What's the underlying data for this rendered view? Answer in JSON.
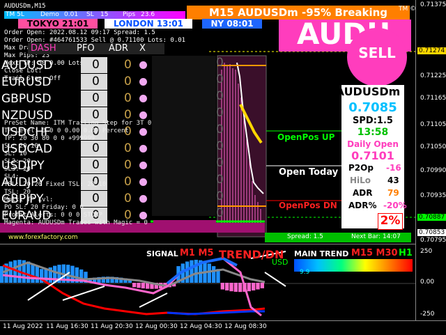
{
  "window": {
    "title": "AUDUSDm,M15"
  },
  "status_line": {
    "tm": "TM 5L",
    "demo": "Demo",
    "demo_val": "0.01",
    "sl_label": "SL",
    "sl_val": "15",
    "pips_label": "Pips",
    "pips_val": "23.6"
  },
  "banner": {
    "text": "M15 AUDUSDm -95% Breaking",
    "badge": "TM ©"
  },
  "sessions": {
    "tokyo": "TOKYO 21:01",
    "london": "LONDON 13:01",
    "ny": "NY 08:01"
  },
  "info_lines": [
    "Order Open:   2022.08.12 09:17    Spread: 1.5",
    "Order Open:   #464761533  Sell @ 0.71100  Lots: 0.01",
    "Max Draw:",
    "Max Pips:     23",
    "Next TP:      50     0.00 Lots:0.01",
    "Close Lot:",
    "Trail Stop:   Off"
  ],
  "tabs": [
    "DASH",
    "PFO",
    "ADR",
    "X"
  ],
  "symbols": [
    {
      "name": "AUDUSD",
      "v1": "0",
      "v2": "0"
    },
    {
      "name": "EURUSD",
      "v1": "0",
      "v2": "0"
    },
    {
      "name": "GBPUSD",
      "v1": "0",
      "v2": "0"
    },
    {
      "name": "NZDUSD",
      "v1": "0",
      "v2": "0"
    },
    {
      "name": "USDCHF",
      "v1": "0",
      "v2": "0"
    },
    {
      "name": "USDCAD",
      "v1": "0",
      "v2": "0"
    },
    {
      "name": "USDJPY",
      "v1": "0",
      "v2": "0"
    },
    {
      "name": "AUDJPY",
      "v1": "0",
      "v2": "0"
    },
    {
      "name": "GBPJPY",
      "v1": "0",
      "v2": "0"
    },
    {
      "name": "EURAUD",
      "v1": "0",
      "v2": "0"
    }
  ],
  "overlay_lines": [
    "PreSet Name:      ITM Trailing Step for 3T    0.03",
    "TP Level:   0   0   0   0.00     0.00     Percent",
    "TP:      20   30   80   0   0   +999999",
    "SL:   20   10",
    "SL:   10",
    "SL2:   20",
    "SL3:   20",
    "SL4:",
    "TSL:   20   20     Fixed TSL:   20   10",
    "TSL:   20",
    "Multi TP Lvl:",
    "PO SL:    20        Friday:  0   0",
    "Profit Alerts:  0   0   0     STOMP",
    "Magenta:   AUDUSDm  Trades with Magic = 0"
  ],
  "overlay_cells": [
    "0",
    "0",
    "0",
    "0",
    "0",
    "0",
    "0",
    "0",
    "0",
    "0"
  ],
  "watermark": "www.forexfactory.com",
  "right_panel": {
    "big_text": "AUDU",
    "sell": "SELL",
    "symbol": "AUDUSDm",
    "price": "0.7085",
    "spd": "SPD:1.5",
    "time": "13:58",
    "daily_open_label": "Daily Open",
    "daily_open": "0.7101",
    "p2op_label": "P2Op",
    "p2op": "-16",
    "hilo_label": "HiLo",
    "hilo": "43",
    "adr_label": "ADR",
    "adr": "79",
    "adrpct_label": "ADR%",
    "adrpct": "-20%",
    "pct_badge": "2%"
  },
  "level_labels": {
    "open_up": "OpenPos UP",
    "open_today": "Open Today",
    "open_dn": "OpenPos DN"
  },
  "bottom_bar": {
    "spread": "Spread:  1.5",
    "next_bar": "Next Bar:  14:07"
  },
  "price_axis": [
    "0.71375",
    "0.71274",
    "0.71225",
    "0.71165",
    "0.71105",
    "0.71050",
    "0.70990",
    "0.70935",
    "0.70887",
    "0.70853",
    "0.70795"
  ],
  "sub_labels": {
    "signal": "SIGNAL",
    "m1m5": "M1 M5",
    "trend": "TREND/DN",
    "main_trend": "MAIN TREND",
    "m15m30": "M15 M30",
    "h1": "H1",
    "usd": "USD",
    "usd_val": "9.9"
  },
  "sub_axis": [
    "250",
    "0.00",
    "-250"
  ],
  "time_axis": [
    "11 Aug 2022",
    "11 Aug 16:30",
    "11 Aug 20:30",
    "12 Aug 00:30",
    "12 Aug 04:30",
    "12 Aug 08:30"
  ],
  "colors": {
    "accent_orange": "#ff7f00",
    "magenta": "#ff3dbd",
    "cyan": "#00ffff",
    "green": "#00ff00",
    "yellow": "#ffff00"
  },
  "chart_data": {
    "type": "bar",
    "title": "",
    "xlabel": "",
    "ylabel": "",
    "ylim": [
      -250,
      250
    ],
    "categories": [
      "11 Aug 2022",
      "11 Aug 16:30",
      "11 Aug 20:30",
      "12 Aug 00:30",
      "12 Aug 04:30",
      "12 Aug 08:30"
    ],
    "series": [
      {
        "values": [
          150,
          120,
          40,
          -40,
          150,
          -60
        ]
      }
    ]
  }
}
